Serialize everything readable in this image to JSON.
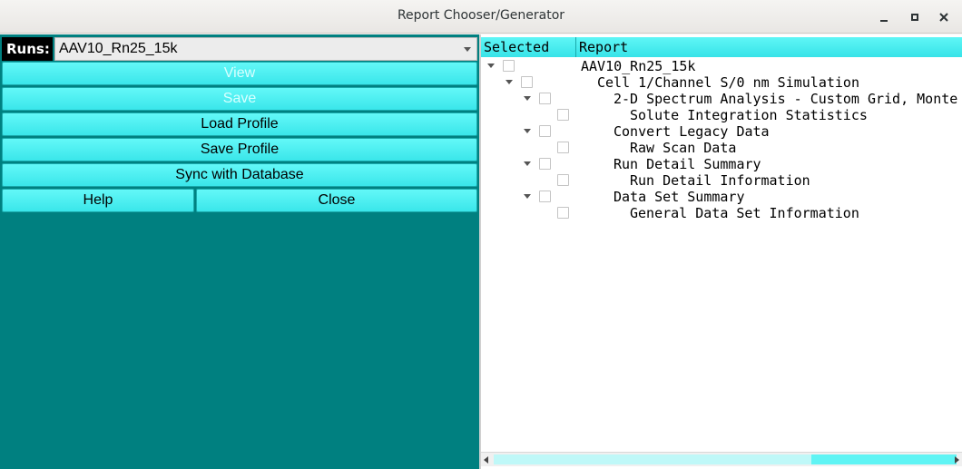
{
  "window": {
    "title": "Report Chooser/Generator"
  },
  "left": {
    "runs_label": "Runs:",
    "runs_selected": "AAV10_Rn25_15k",
    "buttons": {
      "view": "View",
      "save": "Save",
      "load_profile": "Load Profile",
      "save_profile": "Save Profile",
      "sync": "Sync with Database",
      "help": "Help",
      "close": "Close"
    }
  },
  "tree": {
    "columns": [
      "Selected",
      "Report"
    ],
    "rows": [
      {
        "level": 0,
        "expandable": true,
        "label": "AAV10_Rn25_15k"
      },
      {
        "level": 1,
        "expandable": true,
        "label": "Cell 1/Channel S/0 nm   Simulation"
      },
      {
        "level": 2,
        "expandable": true,
        "label": "2-D Spectrum Analysis - Custom Grid, Monte"
      },
      {
        "level": 3,
        "expandable": false,
        "label": "Solute Integration Statistics"
      },
      {
        "level": 2,
        "expandable": true,
        "label": "Convert Legacy Data"
      },
      {
        "level": 3,
        "expandable": false,
        "label": "Raw Scan Data"
      },
      {
        "level": 2,
        "expandable": true,
        "label": "Run Detail Summary"
      },
      {
        "level": 3,
        "expandable": false,
        "label": "Run Detail Information"
      },
      {
        "level": 2,
        "expandable": true,
        "label": "Data Set Summary"
      },
      {
        "level": 3,
        "expandable": false,
        "label": "General Data Set Information"
      }
    ]
  },
  "colors": {
    "background_teal": "#008080",
    "button_cyan": "#4ff0f2",
    "header_cyan": "#45ebee"
  }
}
